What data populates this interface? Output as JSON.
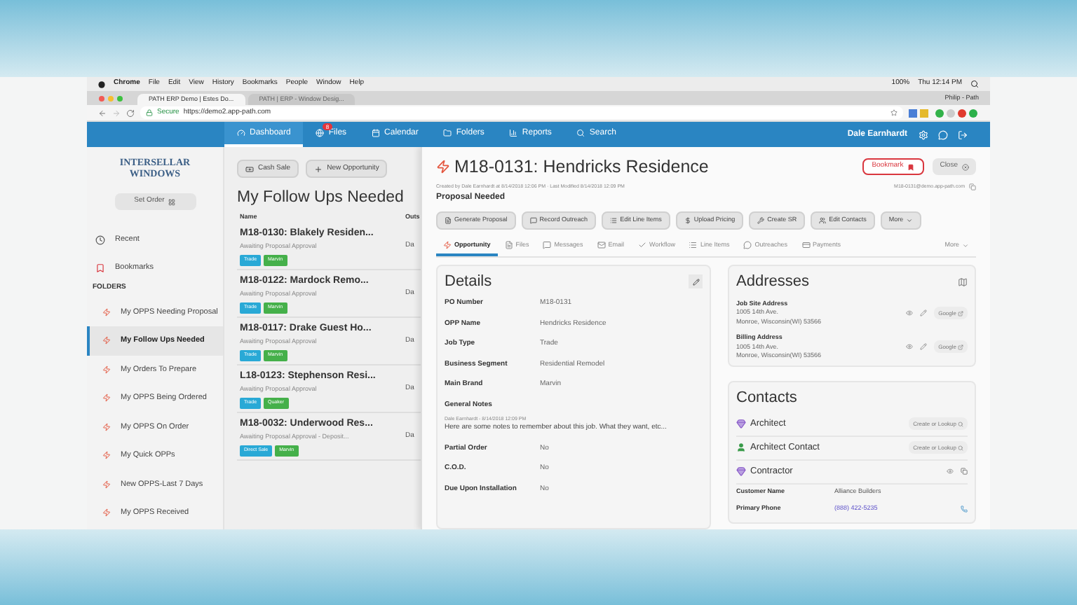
{
  "browser": {
    "menu": [
      "Chrome",
      "File",
      "Edit",
      "View",
      "History",
      "Bookmarks",
      "People",
      "Window",
      "Help"
    ],
    "status": [
      "100%",
      "Thu 12:14 PM"
    ],
    "tabs": [
      {
        "label": "PATH ERP Demo | Estes Do...",
        "selected": true
      },
      {
        "label": "PATH | ERP - Window Desig...",
        "selected": false
      }
    ],
    "profile": "Philip - Path",
    "secure": "Secure",
    "url": "https://demo2.app-path.com"
  },
  "nav": {
    "items": [
      {
        "label": "Dashboard",
        "selected": true
      },
      {
        "label": "Files",
        "selected": false,
        "badge": "8"
      },
      {
        "label": "Calendar",
        "selected": false
      },
      {
        "label": "Folders",
        "selected": false
      },
      {
        "label": "Reports",
        "selected": false
      },
      {
        "label": "Search",
        "selected": false
      }
    ],
    "user": "Dale Earnhardt"
  },
  "sidebar": {
    "logo": "INTERSELLAR WINDOWS",
    "set_order": "Set Order",
    "links": [
      {
        "label": "Recent"
      },
      {
        "label": "Bookmarks"
      }
    ],
    "folders_heading": "FOLDERS",
    "folders": [
      {
        "label": "My OPPS Needing Proposal",
        "selected": false
      },
      {
        "label": "My Follow Ups Needed",
        "selected": true
      },
      {
        "label": "My Orders To Prepare",
        "selected": false
      },
      {
        "label": "My OPPS Being Ordered",
        "selected": false
      },
      {
        "label": "My OPPS On Order",
        "selected": false
      },
      {
        "label": "My Quick OPPs",
        "selected": false
      },
      {
        "label": "New OPPS-Last 7 Days",
        "selected": false
      },
      {
        "label": "My OPPS Received",
        "selected": false
      }
    ]
  },
  "list": {
    "buttons": [
      "Cash Sale",
      "New Opportunity"
    ],
    "title": "My Follow Ups Needed",
    "columns": [
      "Name",
      "Outs"
    ],
    "rows": [
      {
        "title": "M18-0130: Blakely Residen...",
        "status": "Awaiting Proposal Approval",
        "column_2": "Da",
        "tags": [
          {
            "label": "Trade",
            "color": "#29a9d6"
          },
          {
            "label": "Marvin",
            "color": "#45b04a"
          }
        ]
      },
      {
        "title": "M18-0122: Mardock Remo...",
        "status": "Awaiting Proposal Approval",
        "column_2": "Da",
        "tags": [
          {
            "label": "Trade",
            "color": "#29a9d6"
          },
          {
            "label": "Marvin",
            "color": "#45b04a"
          }
        ]
      },
      {
        "title": "M18-0117: Drake Guest Ho...",
        "status": "Awaiting Proposal Approval",
        "column_2": "Da",
        "tags": [
          {
            "label": "Trade",
            "color": "#29a9d6"
          },
          {
            "label": "Marvin",
            "color": "#45b04a"
          }
        ]
      },
      {
        "title": "L18-0123: Stephenson Resi...",
        "status": "Awaiting Proposal Approval",
        "column_2": "Da",
        "tags": [
          {
            "label": "Trade",
            "color": "#29a9d6"
          },
          {
            "label": "Quaker",
            "color": "#45b04a"
          }
        ]
      },
      {
        "title": "M18-0032: Underwood Res...",
        "status": "Awaiting Proposal Approval - Deposit...",
        "column_2": "Da",
        "tags": [
          {
            "label": "Direct Sale",
            "color": "#29a9d6"
          },
          {
            "label": "Marvin",
            "color": "#45b04a"
          }
        ]
      }
    ]
  },
  "detail": {
    "title": "M18-0131: Hendricks Residence",
    "meta": "Created by Dale Earnhardt at 8/14/2018 12:06 PM · Last Modified 8/14/2018 12:09 PM",
    "email": "M18-0131@demo.app-path.com",
    "status": "Proposal Needed",
    "bookmark": "Bookmark",
    "close": "Close",
    "actions": [
      "Generate Proposal",
      "Record Outreach",
      "Edit Line Items",
      "Upload Pricing",
      "Create SR",
      "Edit Contacts",
      "More"
    ],
    "tabs": [
      {
        "label": "Opportunity",
        "selected": true
      },
      {
        "label": "Files",
        "selected": false
      },
      {
        "label": "Messages",
        "selected": false
      },
      {
        "label": "Email",
        "selected": false
      },
      {
        "label": "Workflow",
        "selected": false
      },
      {
        "label": "Line Items",
        "selected": false
      },
      {
        "label": "Outreaches",
        "selected": false
      },
      {
        "label": "Payments",
        "selected": false
      },
      {
        "label": "More",
        "selected": false
      }
    ],
    "details": {
      "title": "Details",
      "fields": [
        {
          "kind": "field",
          "label": "PO Number",
          "value": "M18-0131"
        },
        {
          "kind": "field",
          "label": "OPP Name",
          "value": "Hendricks Residence"
        },
        {
          "kind": "field",
          "label": "Job Type",
          "value": "Trade"
        },
        {
          "kind": "field",
          "label": "Business Segment",
          "value": "Residential Remodel"
        },
        {
          "kind": "field",
          "label": "Main Brand",
          "value": "Marvin"
        },
        {
          "kind": "note",
          "label": "General Notes",
          "author": "Dale Earnhardt - 8/14/2018 12:09 PM",
          "value": "Here are some notes to remember about this job. What they want, etc..."
        },
        {
          "kind": "field",
          "label": "Partial Order",
          "value": "No"
        },
        {
          "kind": "field",
          "label": "C.O.D.",
          "value": "No"
        },
        {
          "kind": "field",
          "label": "Due Upon Installation",
          "value": "No"
        }
      ]
    },
    "addresses": {
      "title": "Addresses",
      "items": [
        {
          "label": "Job Site Address",
          "lines": [
            "1005 14th Ave.",
            "Monroe, Wisconsin(WI) 53566"
          ],
          "map": "Google"
        },
        {
          "label": "Billing Address",
          "lines": [
            "1005 14th Ave.",
            "Monroe, Wisconsin(WI) 53566"
          ],
          "map": "Google"
        }
      ]
    },
    "contacts": {
      "title": "Contacts",
      "roles": [
        {
          "kind": "company",
          "label": "Architect",
          "action": "Create or Lookup"
        },
        {
          "kind": "person",
          "label": "Architect Contact",
          "action": "Create or Lookup"
        },
        {
          "kind": "company",
          "label": "Contractor",
          "fields": [
            {
              "kind": "text",
              "label": "Customer Name",
              "value": "Alliance Builders"
            },
            {
              "kind": "phone",
              "label": "Primary Phone",
              "value": "(888) 422-5235"
            }
          ]
        }
      ]
    }
  }
}
